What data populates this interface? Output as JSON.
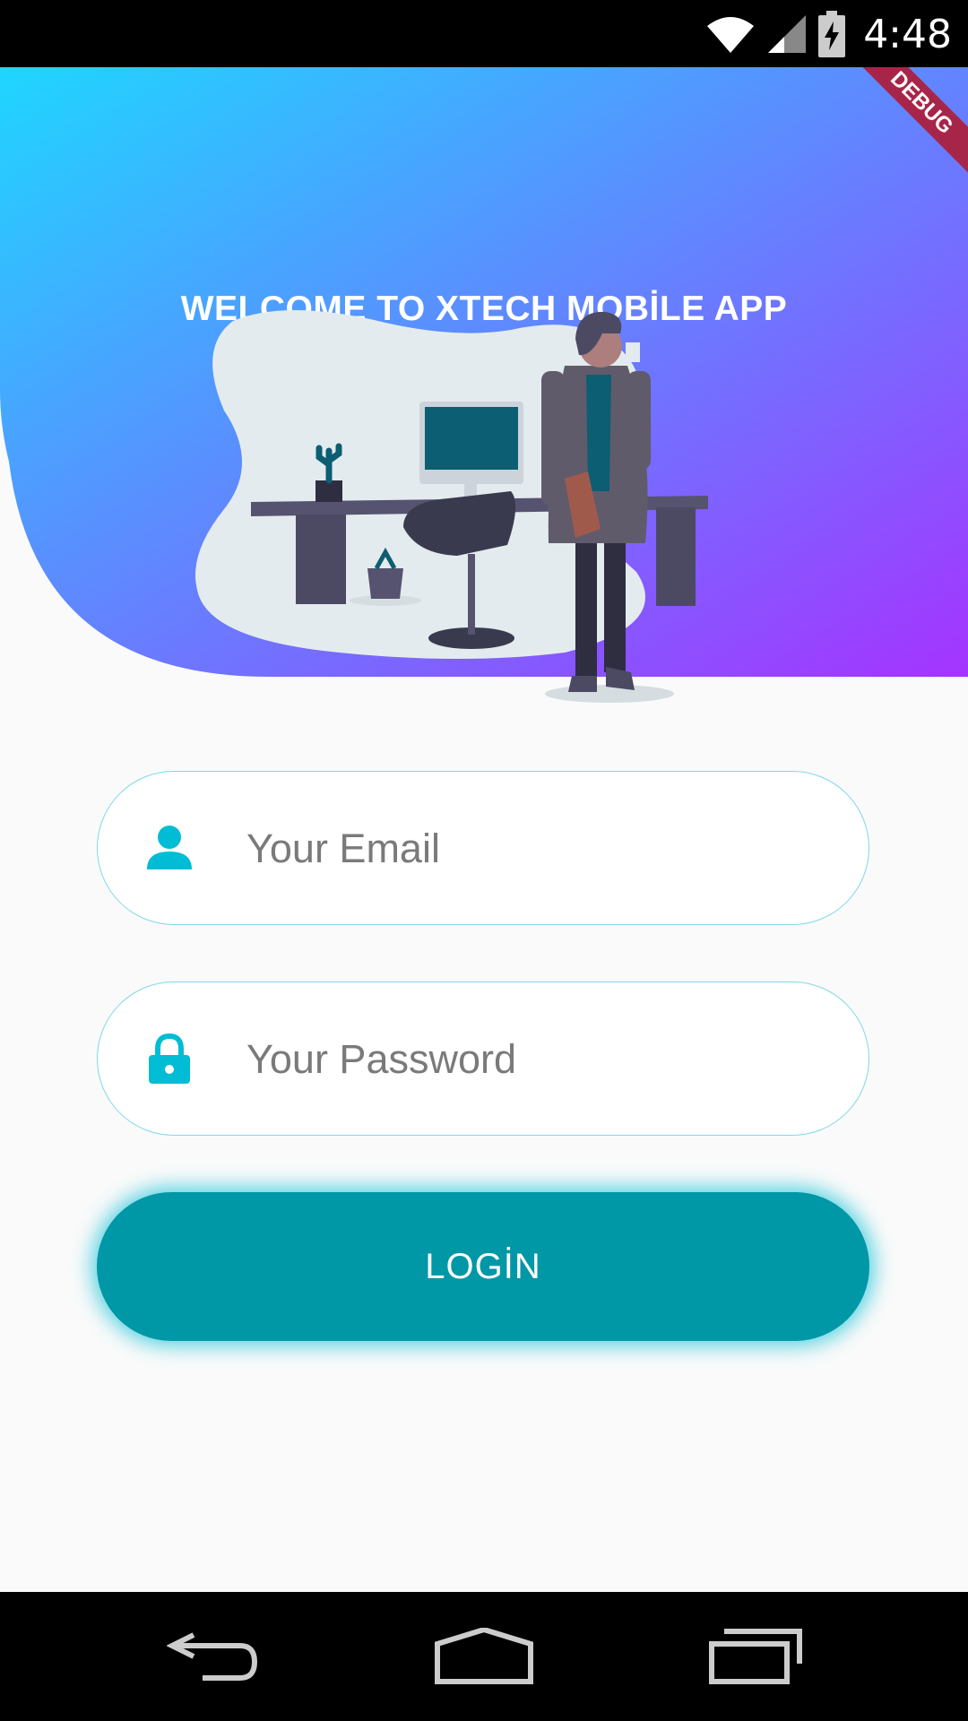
{
  "status_bar": {
    "time": "4:48",
    "icons": [
      "wifi-icon",
      "signal-icon",
      "battery-charging-icon"
    ]
  },
  "debug_banner": {
    "label": "DEBUG"
  },
  "header": {
    "title": "WELCOME TO XTECH MOBİLE APP",
    "gradient_start": "#1fd6ff",
    "gradient_end": "#a533ff"
  },
  "form": {
    "email": {
      "icon": "person-icon",
      "placeholder": "Your Email",
      "value": ""
    },
    "password": {
      "icon": "lock-icon",
      "placeholder": "Your Password",
      "value": ""
    },
    "login_label": "LOGİN",
    "accent_color": "#00bcd4",
    "button_color": "#0097a7"
  },
  "nav_bar": {
    "buttons": [
      "back-icon",
      "home-icon",
      "recents-icon"
    ]
  }
}
